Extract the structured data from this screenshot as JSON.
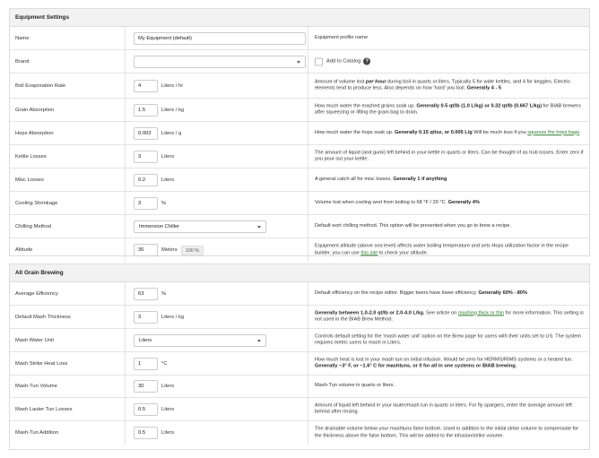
{
  "equipment": {
    "title": "Equipment Settings",
    "name": {
      "label": "Name",
      "value": "My Equipment (default)",
      "desc": "Equipment profile name"
    },
    "brand": {
      "label": "Brand",
      "value": "",
      "add_catalog": "Add to Catalog"
    },
    "boil_evap": {
      "label": "Boil Evaporation Rate",
      "value": "4",
      "unit": "Liters / hr",
      "d1": "Amount of volume lost ",
      "d2": "per hour",
      "d3": " during boil in quarts or liters. Typically 5 for wide kettles, and 4 for keggles. Electric elements tend to produce less. Also depends on how 'hard' you boil. ",
      "d4": "Generally 4 - 5"
    },
    "grain_abs": {
      "label": "Grain Absorption",
      "value": "1.5",
      "unit": "Liters / kg",
      "d1": "How much water the mashed grains soak up. ",
      "d2": "Generally 0.5 qt/lb (1.0 L/kg) or 0.32 qt/lb (0.667 L/kg)",
      "d3": " for BIAB brewers after squeezing or lifting the grain bag to drain."
    },
    "hops_abs": {
      "label": "Hops Absorption",
      "value": "0.003",
      "unit": "Liters / g",
      "d1": "How much water the hops soak up. ",
      "d2": "Generally 0.15 qt/oz, or 0.005 L/g",
      "d3": " Will be much less if you ",
      "d4": "squeeze the hops bags",
      "d5": "."
    },
    "kettle": {
      "label": "Kettle Losses",
      "value": "3",
      "unit": "Liters",
      "d1": "The amount of liquid (and gunk) left behind in your kettle in quarts or liters. Can be thought of as trub losses. Enter zero if you pour out your kettle."
    },
    "misc": {
      "label": "Misc Losses",
      "value": "0.2",
      "unit": "Liters",
      "d1": "A general catch all for misc losses. ",
      "d2": "Generally 1 if anything"
    },
    "cooling": {
      "label": "Cooling Shrinkage",
      "value": "3",
      "unit": "%",
      "d1": "Volume lost when cooling wort from boiling to 68 °F / 20 °C. ",
      "d2": "Generally 4%"
    },
    "chilling": {
      "label": "Chilling Method",
      "value": "Immersion Chiller",
      "d1": "Default wort chilling method. This option will be presented when you go to brew a recipe."
    },
    "altitude": {
      "label": "Altitude",
      "value": "36",
      "unit": "Meters",
      "badge": "100 %",
      "d1": "Equipment altitude (above sea level) affects water boiling temperature and sets Hops utilization factor in the recipe builder, you can use ",
      "d2": "this site",
      "d3": " to check your altitude."
    }
  },
  "allgrain": {
    "title": "All Grain Brewing",
    "efficiency": {
      "label": "Average Efficiency",
      "value": "63",
      "unit": "%",
      "d1": "Default efficiency on the recipe editor. Bigger beers have lower efficiency. ",
      "d2": "Generally 60% - 80%"
    },
    "thickness": {
      "label": "Default Mash Thickness",
      "value": "3",
      "unit": "Liters / kg",
      "d1": "Generally between 1.0-2.0 qt/lb or 2.0-4.0 L/kg.",
      "d2": " See article on ",
      "d3": "mashing thick or thin",
      "d4": " for more information. This setting is not used in the BIAB Brew Method."
    },
    "water_unit": {
      "label": "Mash Water Unit",
      "value": "Liters",
      "d1": "Controls default setting for the 'mash water unit' option on the Brew page for users with their units set to US. The system requires metric users to mash in Liters."
    },
    "heat_loss": {
      "label": "Mash Strike Heat Loss",
      "value": "1",
      "unit": "°C",
      "d1": "How much heat is lost in your mash tun on initial infusion. Would be zero for HERMS/RIMS systems or a heated tun. ",
      "d2": "Generally ~3° F, or ~1.6° C for mashtuns, or 0 for all in one systems or BIAB brewing."
    },
    "tun_volume": {
      "label": "Mash-Tun Volume",
      "value": "30",
      "unit": "Liters",
      "d1": "Mash-Tun volume in quarts or liters."
    },
    "lauter": {
      "label": "Mash Lauter Tun Losses",
      "value": "0.5",
      "unit": "Liters",
      "d1": "Amount of liquid left behind in your lauter/mash tun in quarts or liters. For fly spargers, enter the average amount left behind after rinsing."
    },
    "addition": {
      "label": "Mash-Tun Addition",
      "value": "0.5",
      "unit": "Liters",
      "d1": "The drainable volume below your mashtuns false bottom. Used in addition to the initial strike volume to compensate for the thickness above the false bottom. This will be added to the infusion/strike volume."
    }
  }
}
